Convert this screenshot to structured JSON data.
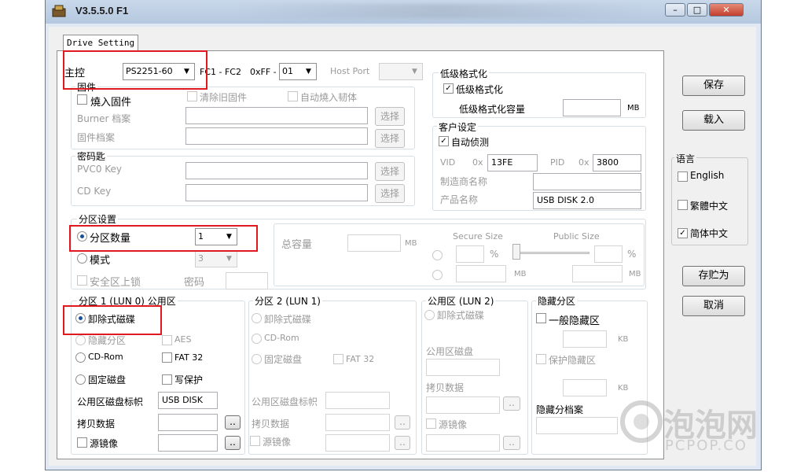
{
  "window": {
    "title": "V3.5.5.0 F1"
  },
  "tab": {
    "label": "Drive Setting"
  },
  "main_ctrl": {
    "label": "主控",
    "controller_value": "PS2251-60",
    "fc_label": "FC1 - FC2",
    "ff_label": "0xFF -",
    "ff_value": "01",
    "host_port_label": "Host Port",
    "host_port_value": ""
  },
  "firmware": {
    "title": "固件",
    "burn_firmware": "燒入固件",
    "clear_old_firmware": "清除旧固件",
    "auto_burn": "自动燒入韧体",
    "burner_label": "Burner 档案",
    "firmware_file_label": "固件档案",
    "browse": "选择"
  },
  "password": {
    "title": "密码匙",
    "pvc0_label": "PVC0 Key",
    "cd_key_label": "CD Key",
    "browse": "选择"
  },
  "low_format": {
    "title": "低级格式化",
    "checkbox": "低级格式化",
    "capacity_label": "低级格式化容量",
    "capacity_unit": "MB"
  },
  "customer": {
    "title": "客户设定",
    "auto_detect": "自动侦测",
    "vid_label": "VID",
    "hex_prefix": "0x",
    "vid_value": "13FE",
    "pid_label": "PID",
    "pid_value": "3800",
    "manufacturer_label": "制造商名称",
    "product_label": "产品名称",
    "product_value": "USB DISK 2.0"
  },
  "partition": {
    "title": "分区设置",
    "count_label": "分区数量",
    "count_value": "1",
    "mode_label": "模式",
    "mode_value": "3",
    "secure_lock": "安全区上锁",
    "password_label": "密码",
    "total_capacity_label": "总容量",
    "mb": "MB",
    "secure_size_label": "Secure Size",
    "public_size_label": "Public Size",
    "percent": "%"
  },
  "p1": {
    "title": "分区 1 (LUN 0) 公用区",
    "removable": "卸除式磁碟",
    "hidden": "隐藏分区",
    "aes": "AES",
    "cdrom": "CD-Rom",
    "fat32": "FAT 32",
    "fixed": "固定磁盘",
    "write_protect": "写保护",
    "volume_label": "公用区磁盘标帜",
    "volume_value": "USB DISK",
    "copy_data": "拷贝数据",
    "source_image": "源镜像",
    "dots": ".."
  },
  "p2": {
    "title": "分区 2 (LUN 1)",
    "removable": "卸除式磁碟",
    "cdrom": "CD-Rom",
    "fixed": "固定磁盘",
    "fat32": "FAT 32",
    "volume_label": "公用区磁盘标帜",
    "copy_data": "拷贝数据",
    "source_image": "源镜像",
    "dots": ".."
  },
  "public": {
    "title": "公用区 (LUN 2)",
    "removable": "卸除式磁碟",
    "disk_label": "公用区磁盘",
    "copy_data": "拷贝数据",
    "source_image": "源镜像",
    "dots": ".."
  },
  "hidden": {
    "title": "隐藏分区",
    "general_hidden": "一般隐藏区",
    "protect_hidden": "保护隐藏区",
    "kb": "KB",
    "hidden_file": "隐藏分档案"
  },
  "side": {
    "save": "保存",
    "load": "载入",
    "language_title": "语言",
    "english": "English",
    "traditional": "繁體中文",
    "simplified": "简体中文",
    "save_as": "存贮为",
    "cancel": "取消"
  },
  "watermark": {
    "text": "泡泡网",
    "sub": "PCPOP.CO"
  }
}
